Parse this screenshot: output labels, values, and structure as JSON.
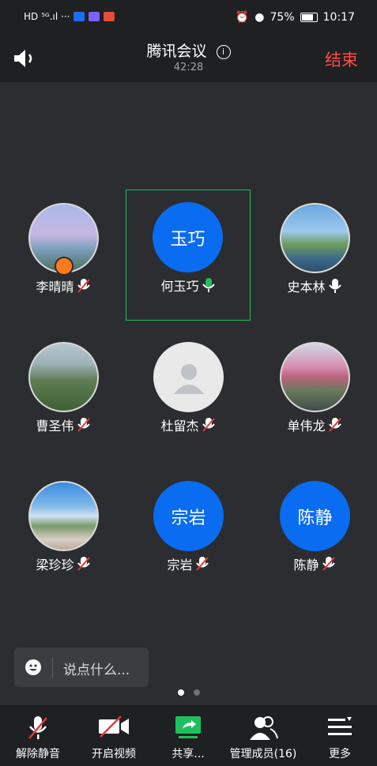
{
  "status_bar": {
    "left_text": "HD ⁵ᴳ.ıl ···",
    "battery": "75%",
    "time": "10:17"
  },
  "header": {
    "title": "腾讯会议",
    "timer": "42:28",
    "end_label": "结束"
  },
  "participants": [
    {
      "name": "李晴晴",
      "avatar_type": "photo",
      "mic": "muted",
      "host": true
    },
    {
      "name": "何玉巧",
      "avatar_type": "initials",
      "avatar_text": "玉巧",
      "mic": "active",
      "speaking": true
    },
    {
      "name": "史本林",
      "avatar_type": "photo",
      "mic": "on"
    },
    {
      "name": "曹圣伟",
      "avatar_type": "photo",
      "mic": "muted"
    },
    {
      "name": "杜留杰",
      "avatar_type": "placeholder",
      "mic": "muted"
    },
    {
      "name": "单伟龙",
      "avatar_type": "photo",
      "mic": "muted"
    },
    {
      "name": "梁珍珍",
      "avatar_type": "photo",
      "mic": "muted"
    },
    {
      "name": "宗岩",
      "avatar_type": "initials",
      "avatar_text": "宗岩",
      "mic": "muted"
    },
    {
      "name": "陈静",
      "avatar_type": "initials",
      "avatar_text": "陈静",
      "mic": "muted"
    }
  ],
  "chat": {
    "placeholder": "说点什么..."
  },
  "pager": {
    "pages": 2,
    "current": 1
  },
  "toolbar": {
    "unmute": "解除静音",
    "video": "开启视频",
    "share": "共享...",
    "members": "管理成员(16)",
    "more": "更多"
  },
  "colors": {
    "accent_blue": "#0a6cf0",
    "end_red": "#ff4a4a",
    "speaking_green": "#1fbf5f"
  }
}
